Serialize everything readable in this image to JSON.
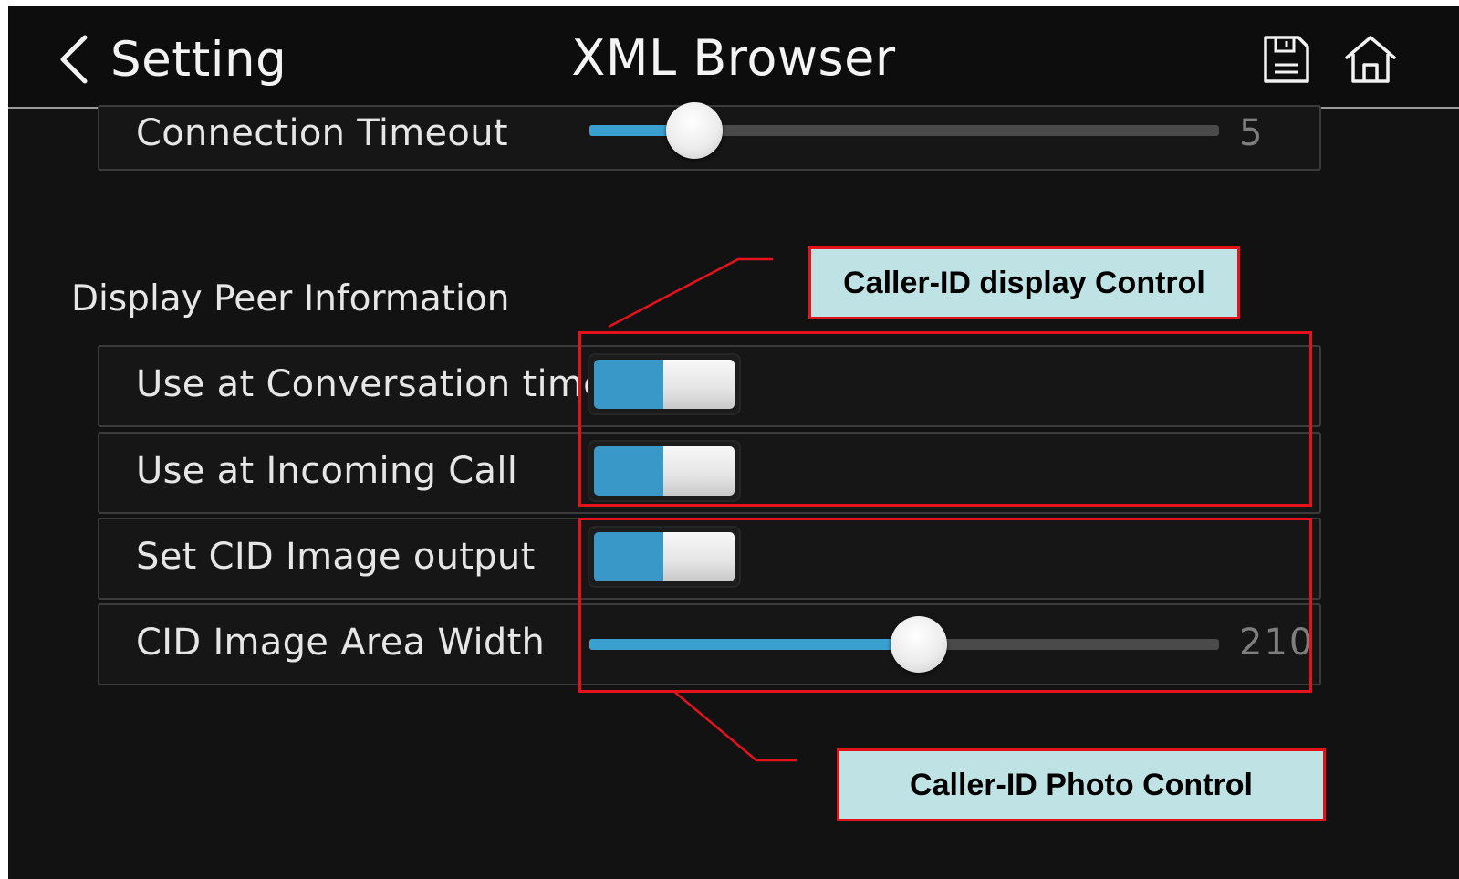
{
  "header": {
    "back_label": "Setting",
    "title": "XML Browser",
    "icons": [
      "chevron-left-icon",
      "save-icon",
      "home-icon"
    ]
  },
  "connection_timeout": {
    "label": "Connection Timeout",
    "value": "5",
    "fill_fraction": 0.16
  },
  "section": {
    "title": "Display Peer Information"
  },
  "rows": [
    {
      "label": "Use at Conversation time",
      "type": "toggle",
      "state": "on"
    },
    {
      "label": "Use at Incoming Call",
      "type": "toggle",
      "state": "on"
    },
    {
      "label": "Set CID Image output",
      "type": "toggle",
      "state": "on"
    },
    {
      "label": "CID Image Area Width",
      "type": "slider",
      "value": "210",
      "fill_fraction": 0.52
    }
  ],
  "annotations": {
    "callout_display": "Caller-ID display Control",
    "callout_photo": "Caller-ID Photo Control",
    "color": "#e3121b",
    "callout_bg": "#bfe2e4"
  },
  "colors": {
    "accent": "#3aa0d0",
    "background": "#121212"
  }
}
